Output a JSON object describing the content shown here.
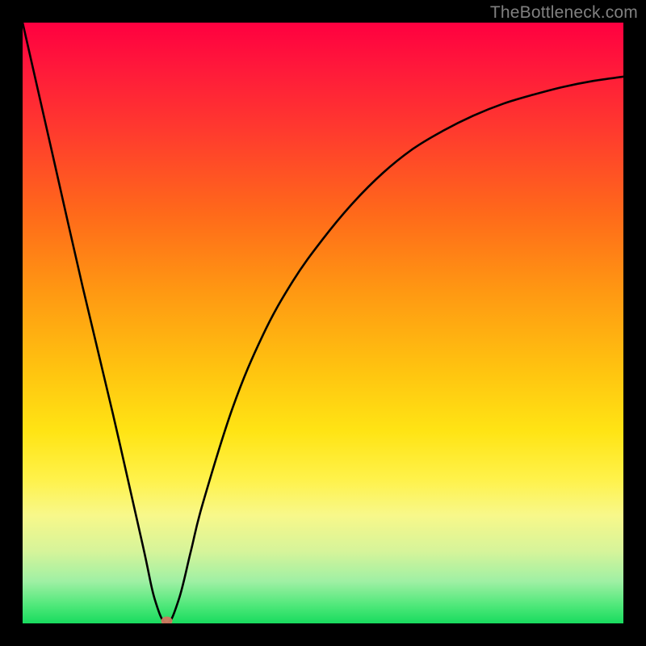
{
  "watermark": "TheBottleneck.com",
  "chart_data": {
    "type": "line",
    "title": "",
    "xlabel": "",
    "ylabel": "",
    "xlim": [
      0,
      100
    ],
    "ylim": [
      0,
      100
    ],
    "grid": false,
    "background": "red-to-green vertical gradient (bottleneck heatmap)",
    "series": [
      {
        "name": "bottleneck-curve",
        "x": [
          0,
          5,
          10,
          15,
          20,
          22,
          24,
          26,
          28,
          30,
          35,
          40,
          45,
          50,
          55,
          60,
          65,
          70,
          75,
          80,
          85,
          90,
          95,
          100
        ],
        "y": [
          100,
          78,
          56,
          35,
          13,
          4,
          0,
          4,
          12,
          20,
          36,
          48,
          57,
          64,
          70,
          75,
          79,
          82,
          84.5,
          86.5,
          88,
          89.3,
          90.3,
          91
        ]
      }
    ],
    "marker": {
      "name": "optimal-point",
      "x": 24,
      "y": 0,
      "color": "#d07860"
    }
  }
}
